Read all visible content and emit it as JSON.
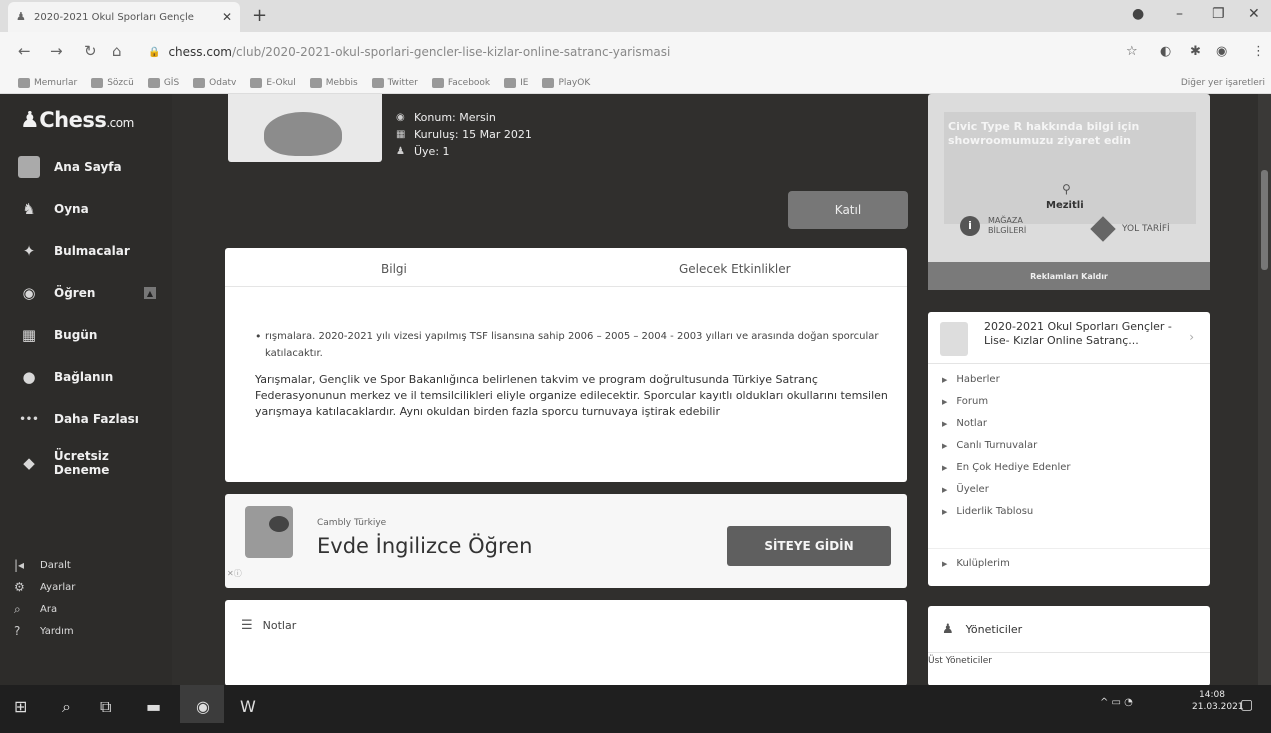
{
  "browser": {
    "tab_title": "2020-2021 Okul Sporları Gençle",
    "url_host": "chess.com",
    "url_path": "/club/2020-2021-okul-sporlari-gencler-lise-kizlar-online-satranc-yarismasi",
    "bookmarks": [
      "Memurlar",
      "Sözcü",
      "GİS",
      "Odatv",
      "E-Okul",
      "Mebbis",
      "Twitter",
      "Facebook",
      "IE",
      "PlayOK"
    ],
    "other_bookmarks": "Diğer yer işaretleri"
  },
  "sidebar": {
    "logo": "Chess",
    "logo_suffix": ".com",
    "items": [
      {
        "label": "Ana Sayfa"
      },
      {
        "label": "Oyna"
      },
      {
        "label": "Bulmacalar"
      },
      {
        "label": "Öğren"
      },
      {
        "label": "Bugün"
      },
      {
        "label": "Bağlanın"
      },
      {
        "label": "Daha Fazlası"
      },
      {
        "label": "Ücretsiz Deneme"
      }
    ],
    "bottom": [
      {
        "label": "Daralt"
      },
      {
        "label": "Ayarlar"
      },
      {
        "label": "Ara"
      },
      {
        "label": "Yardım"
      }
    ]
  },
  "club": {
    "location": "Konum: Mersin",
    "founded": "Kuruluş: 15 Mar 2021",
    "members": "Üye: 1",
    "join_label": "Katıl",
    "tabs": [
      "Bilgi",
      "Gelecek Etkinlikler"
    ],
    "bullet_text": "rışmalara. 2020-2021 yılı vizesi yapılmış TSF lisansına sahip 2006 – 2005 – 2004 - 2003 yılları ve arasında doğan sporcular katılacaktır.",
    "paragraph": "Yarışmalar, Gençlik ve Spor Bakanlığınca belirlenen takvim ve program doğrultusunda Türkiye Satranç Federasyonunun merkez ve il temsilcilikleri eliyle organize edilecektir. Sporcular kayıtlı oldukları okullarını temsilen yarışmaya katılacaklardır. Aynı okuldan birden fazla sporcu turnuvaya iştirak edebilir"
  },
  "ad": {
    "brand": "Cambly Türkiye",
    "headline": "Evde İngilizce Öğren",
    "cta": "SİTEYE GİDİN",
    "close": "✕ⓘ"
  },
  "notes": {
    "title": "Notlar"
  },
  "promo": {
    "text": "Civic Type R hakkında bilgi için showroomumuzu ziyaret edin",
    "location": "Mezitli",
    "info_label_1": "MAĞAZA",
    "info_label_2": "BİLGİLERİ",
    "directions": "YOL TARİFİ",
    "remove_ads": "Reklamları Kaldır"
  },
  "club_card": {
    "name": "2020-2021 Okul Sporları Gençler -Lise- Kızlar Online Satranç...",
    "links": [
      "Haberler",
      "Forum",
      "Notlar",
      "Canlı Turnuvalar",
      "En Çok Hediye Edenler",
      "Üyeler",
      "Liderlik Tablosu"
    ],
    "my_clubs": "Kulüplerim"
  },
  "admins": {
    "title": "Yöneticiler",
    "sub": "Üst Yöneticiler"
  },
  "taskbar": {
    "time": "14:08",
    "date": "21.03.2021"
  }
}
